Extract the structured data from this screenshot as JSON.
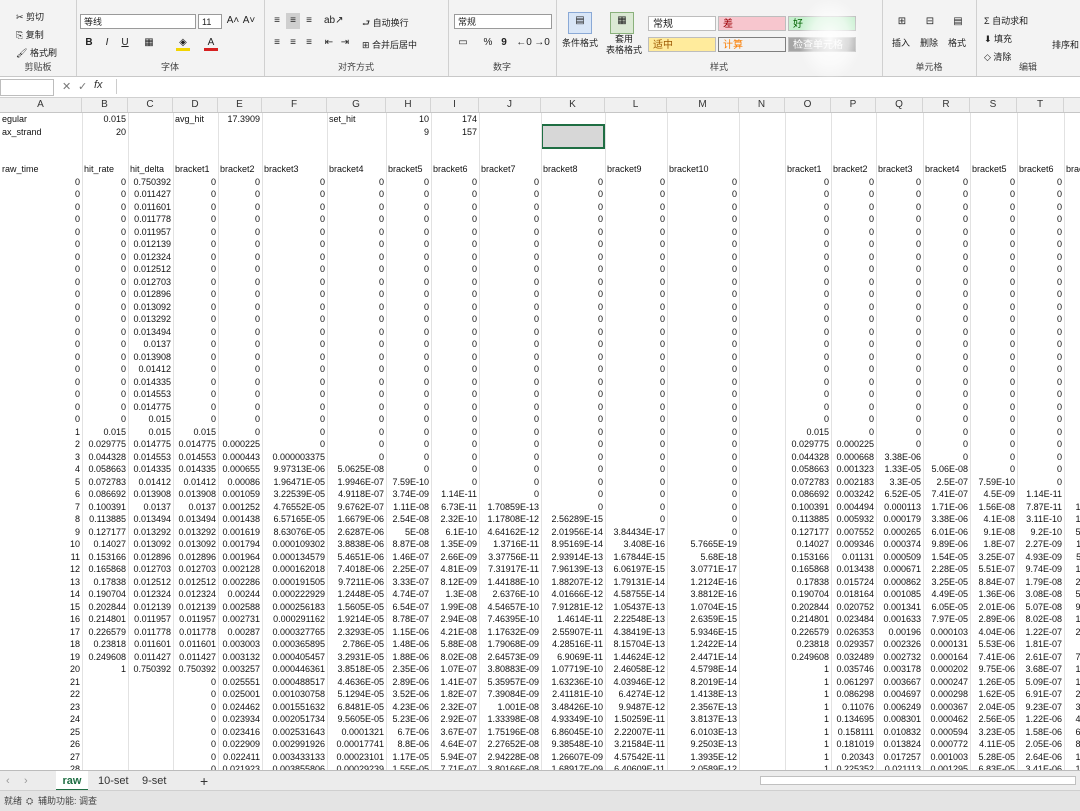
{
  "ribbon": {
    "clipboard": {
      "cut": "剪切",
      "copy": "复制",
      "format_painter": "格式刷",
      "label": "剪贴板"
    },
    "font": {
      "name": "等线",
      "size": "11",
      "label": "字体",
      "bold": "B",
      "italic": "I",
      "underline": "U",
      "grow": "A˄",
      "shrink": "A˅"
    },
    "alignment": {
      "wrap": "自动换行",
      "merge": "合并后居中",
      "label": "对齐方式"
    },
    "number": {
      "format": "常规",
      "percent": "%",
      "comma": "9",
      "label": "数字"
    },
    "styles": {
      "conditional": "条件格式",
      "table": "套用\n表格格式",
      "normal": "常规",
      "bad": "差",
      "good": "好",
      "neutral": "适中",
      "calc": "计算",
      "check": "检查单元格",
      "label": "样式"
    },
    "cells": {
      "insert": "插入",
      "delete": "删除",
      "format": "格式",
      "label": "单元格"
    },
    "editing": {
      "autosum": "自动求和",
      "fill": "填充",
      "clear": "清除",
      "sort": "排序和",
      "label": "编辑"
    }
  },
  "formula_bar": {
    "fx": "fx",
    "value": ""
  },
  "columns": [
    "A",
    "B",
    "C",
    "D",
    "E",
    "F",
    "G",
    "H",
    "I",
    "J",
    "K",
    "L",
    "M",
    "N",
    "O",
    "P",
    "Q",
    "R",
    "S",
    "T",
    "U"
  ],
  "top_rows": [
    [
      "egular",
      "0.015",
      "",
      "avg_hit",
      "17.3909",
      "",
      "set_hit",
      "10",
      "174"
    ],
    [
      "ax_strand",
      "20",
      "",
      "",
      "",
      "",
      "",
      "9",
      "157"
    ]
  ],
  "headers_left": [
    "raw_time",
    "hit_rate",
    "hit_delta",
    "bracket1",
    "bracket2",
    "bracket3",
    "bracket4",
    "bracket5",
    "bracket6",
    "bracket7",
    "bracket8",
    "bracket9",
    "bracket10"
  ],
  "headers_right": [
    "bracket1",
    "bracket2",
    "bracket3",
    "bracket4",
    "bracket5",
    "bracket6",
    "bracket7"
  ],
  "rows": [
    [
      "0",
      "0",
      "0.750392",
      "0",
      "0",
      "0",
      "0",
      "0",
      "0",
      "0",
      "0",
      "0",
      "0",
      "",
      "0",
      "0",
      "0",
      "0",
      "0",
      "0",
      "0"
    ],
    [
      "0",
      "0",
      "0.011427",
      "0",
      "0",
      "0",
      "0",
      "0",
      "0",
      "0",
      "0",
      "0",
      "0",
      "",
      "0",
      "0",
      "0",
      "0",
      "0",
      "0",
      "0"
    ],
    [
      "0",
      "0",
      "0.011601",
      "0",
      "0",
      "0",
      "0",
      "0",
      "0",
      "0",
      "0",
      "0",
      "0",
      "",
      "0",
      "0",
      "0",
      "0",
      "0",
      "0",
      "0"
    ],
    [
      "0",
      "0",
      "0.011778",
      "0",
      "0",
      "0",
      "0",
      "0",
      "0",
      "0",
      "0",
      "0",
      "0",
      "",
      "0",
      "0",
      "0",
      "0",
      "0",
      "0",
      "0"
    ],
    [
      "0",
      "0",
      "0.011957",
      "0",
      "0",
      "0",
      "0",
      "0",
      "0",
      "0",
      "0",
      "0",
      "0",
      "",
      "0",
      "0",
      "0",
      "0",
      "0",
      "0",
      "0"
    ],
    [
      "0",
      "0",
      "0.012139",
      "0",
      "0",
      "0",
      "0",
      "0",
      "0",
      "0",
      "0",
      "0",
      "0",
      "",
      "0",
      "0",
      "0",
      "0",
      "0",
      "0",
      "0"
    ],
    [
      "0",
      "0",
      "0.012324",
      "0",
      "0",
      "0",
      "0",
      "0",
      "0",
      "0",
      "0",
      "0",
      "0",
      "",
      "0",
      "0",
      "0",
      "0",
      "0",
      "0",
      "0"
    ],
    [
      "0",
      "0",
      "0.012512",
      "0",
      "0",
      "0",
      "0",
      "0",
      "0",
      "0",
      "0",
      "0",
      "0",
      "",
      "0",
      "0",
      "0",
      "0",
      "0",
      "0",
      "0"
    ],
    [
      "0",
      "0",
      "0.012703",
      "0",
      "0",
      "0",
      "0",
      "0",
      "0",
      "0",
      "0",
      "0",
      "0",
      "",
      "0",
      "0",
      "0",
      "0",
      "0",
      "0",
      "0"
    ],
    [
      "0",
      "0",
      "0.012896",
      "0",
      "0",
      "0",
      "0",
      "0",
      "0",
      "0",
      "0",
      "0",
      "0",
      "",
      "0",
      "0",
      "0",
      "0",
      "0",
      "0",
      "0"
    ],
    [
      "0",
      "0",
      "0.013092",
      "0",
      "0",
      "0",
      "0",
      "0",
      "0",
      "0",
      "0",
      "0",
      "0",
      "",
      "0",
      "0",
      "0",
      "0",
      "0",
      "0",
      "0"
    ],
    [
      "0",
      "0",
      "0.013292",
      "0",
      "0",
      "0",
      "0",
      "0",
      "0",
      "0",
      "0",
      "0",
      "0",
      "",
      "0",
      "0",
      "0",
      "0",
      "0",
      "0",
      "0"
    ],
    [
      "0",
      "0",
      "0.013494",
      "0",
      "0",
      "0",
      "0",
      "0",
      "0",
      "0",
      "0",
      "0",
      "0",
      "",
      "0",
      "0",
      "0",
      "0",
      "0",
      "0",
      "0"
    ],
    [
      "0",
      "0",
      "0.0137",
      "0",
      "0",
      "0",
      "0",
      "0",
      "0",
      "0",
      "0",
      "0",
      "0",
      "",
      "0",
      "0",
      "0",
      "0",
      "0",
      "0",
      "0"
    ],
    [
      "0",
      "0",
      "0.013908",
      "0",
      "0",
      "0",
      "0",
      "0",
      "0",
      "0",
      "0",
      "0",
      "0",
      "",
      "0",
      "0",
      "0",
      "0",
      "0",
      "0",
      "0"
    ],
    [
      "0",
      "0",
      "0.01412",
      "0",
      "0",
      "0",
      "0",
      "0",
      "0",
      "0",
      "0",
      "0",
      "0",
      "",
      "0",
      "0",
      "0",
      "0",
      "0",
      "0",
      "0"
    ],
    [
      "0",
      "0",
      "0.014335",
      "0",
      "0",
      "0",
      "0",
      "0",
      "0",
      "0",
      "0",
      "0",
      "0",
      "",
      "0",
      "0",
      "0",
      "0",
      "0",
      "0",
      "0"
    ],
    [
      "0",
      "0",
      "0.014553",
      "0",
      "0",
      "0",
      "0",
      "0",
      "0",
      "0",
      "0",
      "0",
      "0",
      "",
      "0",
      "0",
      "0",
      "0",
      "0",
      "0",
      "0"
    ],
    [
      "0",
      "0",
      "0.014775",
      "0",
      "0",
      "0",
      "0",
      "0",
      "0",
      "0",
      "0",
      "0",
      "0",
      "",
      "0",
      "0",
      "0",
      "0",
      "0",
      "0",
      "0"
    ],
    [
      "0",
      "0",
      "0.015",
      "0",
      "0",
      "0",
      "0",
      "0",
      "0",
      "0",
      "0",
      "0",
      "0",
      "",
      "0",
      "0",
      "0",
      "0",
      "0",
      "0",
      "0"
    ],
    [
      "1",
      "0.015",
      "0.015",
      "0.015",
      "0",
      "0",
      "0",
      "0",
      "0",
      "0",
      "0",
      "0",
      "0",
      "",
      "0.015",
      "0",
      "0",
      "0",
      "0",
      "0",
      "0"
    ],
    [
      "2",
      "0.029775",
      "0.014775",
      "0.014775",
      "0.000225",
      "0",
      "0",
      "0",
      "0",
      "0",
      "0",
      "0",
      "0",
      "",
      "0.029775",
      "0.000225",
      "0",
      "0",
      "0",
      "0",
      "0"
    ],
    [
      "3",
      "0.044328",
      "0.014553",
      "0.014553",
      "0.000443",
      "0.000003375",
      "0",
      "0",
      "0",
      "0",
      "0",
      "0",
      "0",
      "",
      "0.044328",
      "0.000668",
      "3.38E-06",
      "0",
      "0",
      "0",
      "0"
    ],
    [
      "4",
      "0.058663",
      "0.014335",
      "0.014335",
      "0.000655",
      "9.97313E-06",
      "5.0625E-08",
      "0",
      "0",
      "0",
      "0",
      "0",
      "0",
      "",
      "0.058663",
      "0.001323",
      "1.33E-05",
      "5.06E-08",
      "0",
      "0",
      "0"
    ],
    [
      "5",
      "0.072783",
      "0.01412",
      "0.01412",
      "0.00086",
      "1.96471E-05",
      "1.9946E-07",
      "7.59E-10",
      "0",
      "0",
      "0",
      "0",
      "0",
      "",
      "0.072783",
      "0.002183",
      "3.3E-05",
      "2.5E-07",
      "7.59E-10",
      "0",
      "0"
    ],
    [
      "6",
      "0.086692",
      "0.013908",
      "0.013908",
      "0.001059",
      "3.22539E-05",
      "4.9118E-07",
      "3.74E-09",
      "1.14E-11",
      "0",
      "0",
      "0",
      "0",
      "",
      "0.086692",
      "0.003242",
      "6.52E-05",
      "7.41E-07",
      "4.5E-09",
      "1.14E-11",
      "0"
    ],
    [
      "7",
      "0.100391",
      "0.0137",
      "0.0137",
      "0.001252",
      "4.76552E-05",
      "9.6762E-07",
      "1.11E-08",
      "6.73E-11",
      "1.70859E-13",
      "0",
      "0",
      "0",
      "",
      "0.100391",
      "0.004494",
      "0.000113",
      "1.71E-06",
      "1.56E-08",
      "7.87E-11",
      "1.71E-13"
    ],
    [
      "8",
      "0.113885",
      "0.013494",
      "0.013494",
      "0.001438",
      "6.57165E-05",
      "1.6679E-06",
      "2.54E-08",
      "2.32E-10",
      "1.17808E-12",
      "2.56289E-15",
      "0",
      "0",
      "",
      "0.113885",
      "0.005932",
      "0.000179",
      "3.38E-06",
      "4.1E-08",
      "3.11E-10",
      "1.35E-12"
    ],
    [
      "9",
      "0.127177",
      "0.013292",
      "0.013292",
      "0.001619",
      "8.63076E-05",
      "2.6287E-06",
      "5E-08",
      "6.1E-10",
      "4.64162E-12",
      "2.01956E-14",
      "3.84434E-17",
      "0",
      "",
      "0.127177",
      "0.007552",
      "0.000265",
      "6.01E-06",
      "9.1E-08",
      "9.2E-10",
      "5.99E-12"
    ],
    [
      "10",
      "0.14027",
      "0.013092",
      "0.013092",
      "0.001794",
      "0.000109302",
      "3.8838E-06",
      "8.87E-08",
      "1.35E-09",
      "1.3716E-11",
      "8.95169E-14",
      "3.408E-16",
      "5.7665E-19",
      "",
      "0.14027",
      "0.009346",
      "0.000374",
      "9.89E-06",
      "1.8E-07",
      "2.27E-09",
      "1.97E-11"
    ],
    [
      "11",
      "0.153166",
      "0.012896",
      "0.012896",
      "0.001964",
      "0.000134579",
      "5.4651E-06",
      "1.46E-07",
      "2.66E-09",
      "3.37756E-11",
      "2.93914E-13",
      "1.67844E-15",
      "5.68E-18",
      "",
      "0.153166",
      "0.01131",
      "0.000509",
      "1.54E-05",
      "3.25E-07",
      "4.93E-09",
      "5.35E-11"
    ],
    [
      "12",
      "0.165868",
      "0.012703",
      "0.012703",
      "0.002128",
      "0.000162018",
      "7.4018E-06",
      "2.25E-07",
      "4.81E-09",
      "7.31917E-11",
      "7.96139E-13",
      "6.06197E-15",
      "3.0771E-17",
      "",
      "0.165868",
      "0.013438",
      "0.000671",
      "2.28E-05",
      "5.51E-07",
      "9.74E-09",
      "1.27E-10"
    ],
    [
      "13",
      "0.17838",
      "0.012512",
      "0.012512",
      "0.002286",
      "0.000191505",
      "9.7211E-06",
      "3.33E-07",
      "8.12E-09",
      "1.44188E-10",
      "1.88207E-12",
      "1.79131E-14",
      "1.2124E-16",
      "",
      "0.17838",
      "0.015724",
      "0.000862",
      "3.25E-05",
      "8.84E-07",
      "1.79E-08",
      "2.71E-10"
    ],
    [
      "14",
      "0.190704",
      "0.012324",
      "0.012324",
      "0.00244",
      "0.000222929",
      "1.2448E-05",
      "4.74E-07",
      "1.3E-08",
      "2.6376E-10",
      "4.01666E-12",
      "4.58755E-14",
      "3.8812E-16",
      "",
      "0.190704",
      "0.018164",
      "0.001085",
      "4.49E-05",
      "1.36E-06",
      "3.08E-08",
      "5.35E-10"
    ],
    [
      "15",
      "0.202844",
      "0.012139",
      "0.012139",
      "0.002588",
      "0.000256183",
      "1.5605E-05",
      "6.54E-07",
      "1.99E-08",
      "4.54657E-10",
      "7.91281E-12",
      "1.05437E-13",
      "1.0704E-15",
      "",
      "0.202844",
      "0.020752",
      "0.001341",
      "6.05E-05",
      "2.01E-06",
      "5.07E-08",
      "9.89E-10"
    ],
    [
      "16",
      "0.214801",
      "0.011957",
      "0.011957",
      "0.002731",
      "0.000291162",
      "1.9214E-05",
      "8.78E-07",
      "2.94E-08",
      "7.46395E-10",
      "1.4614E-11",
      "2.22548E-13",
      "2.6359E-15",
      "",
      "0.214801",
      "0.023484",
      "0.001633",
      "7.97E-05",
      "2.89E-06",
      "8.02E-08",
      "1.74E-09"
    ],
    [
      "17",
      "0.226579",
      "0.011778",
      "0.011778",
      "0.00287",
      "0.000327765",
      "2.3293E-05",
      "1.15E-06",
      "4.21E-08",
      "1.17632E-09",
      "2.55907E-11",
      "4.38419E-13",
      "5.9346E-15",
      "",
      "0.226579",
      "0.026353",
      "0.00196",
      "0.000103",
      "4.04E-06",
      "1.22E-07",
      "2.91E-09"
    ],
    [
      "18",
      "0.23818",
      "0.011601",
      "0.011601",
      "0.003003",
      "0.000365895",
      "2.786E-05",
      "1.48E-06",
      "5.88E-08",
      "1.79068E-09",
      "4.28516E-11",
      "8.15704E-13",
      "1.2422E-14",
      "",
      "0.23818",
      "0.029357",
      "0.002326",
      "0.000131",
      "5.53E-06",
      "1.81E-07",
      "4.7E-09"
    ],
    [
      "19",
      "0.249608",
      "0.011427",
      "0.011427",
      "0.003132",
      "0.000405457",
      "3.2931E-05",
      "1.88E-06",
      "8.02E-08",
      "2.64573E-09",
      "6.9069E-11",
      "1.44624E-12",
      "2.4471E-14",
      "",
      "0.249608",
      "0.032489",
      "0.002732",
      "0.000164",
      "7.41E-06",
      "2.61E-07",
      "7.35E-09"
    ],
    [
      "20",
      "1",
      "0.750392",
      "0.750392",
      "0.003257",
      "0.000446361",
      "3.8518E-05",
      "2.35E-06",
      "1.07E-07",
      "3.80883E-09",
      "1.07719E-10",
      "2.46058E-12",
      "4.5798E-14",
      "",
      "1",
      "0.035746",
      "0.003178",
      "0.000202",
      "9.75E-06",
      "3.68E-07",
      "1.12E-08"
    ],
    [
      "21",
      "",
      "",
      "0",
      "0.025551",
      "0.000488517",
      "4.4636E-05",
      "2.89E-06",
      "1.41E-07",
      "5.35957E-09",
      "1.63236E-10",
      "4.03946E-12",
      "8.2019E-14",
      "",
      "1",
      "0.061297",
      "0.003667",
      "0.000247",
      "1.26E-05",
      "5.09E-07",
      "1.65E-08"
    ],
    [
      "22",
      "",
      "",
      "0",
      "0.025001",
      "0.001030758",
      "5.1294E-05",
      "3.52E-06",
      "1.82E-07",
      "7.39084E-09",
      "2.41181E-10",
      "6.4274E-12",
      "1.4138E-13",
      "",
      "1",
      "0.086298",
      "0.004697",
      "0.000298",
      "1.62E-05",
      "6.91E-07",
      "2.39E-08"
    ],
    [
      "23",
      "",
      "",
      "0",
      "0.024462",
      "0.001551632",
      "6.8481E-05",
      "4.23E-06",
      "2.32E-07",
      "1.001E-08",
      "3.48426E-10",
      "9.9487E-12",
      "2.3567E-13",
      "",
      "1",
      "0.11076",
      "0.006249",
      "0.000367",
      "2.04E-05",
      "9.23E-07",
      "3.39E-08"
    ],
    [
      "24",
      "",
      "",
      "0",
      "0.023934",
      "0.002051734",
      "9.5605E-05",
      "5.23E-06",
      "2.92E-07",
      "1.33398E-08",
      "4.93349E-10",
      "1.50259E-11",
      "3.8137E-13",
      "",
      "1",
      "0.134695",
      "0.008301",
      "0.000462",
      "2.56E-05",
      "1.22E-06",
      "4.73E-08"
    ],
    [
      "25",
      "",
      "",
      "0",
      "0.023416",
      "0.002531643",
      "0.0001321",
      "6.7E-06",
      "3.67E-07",
      "1.75196E-08",
      "6.86045E-10",
      "2.22007E-11",
      "6.0103E-13",
      "",
      "1",
      "0.158111",
      "0.010832",
      "0.000594",
      "3.23E-05",
      "1.58E-06",
      "6.48E-08"
    ],
    [
      "26",
      "",
      "",
      "0",
      "0.022909",
      "0.002991926",
      "0.00017741",
      "8.8E-06",
      "4.64E-07",
      "2.27652E-08",
      "9.38548E-10",
      "3.21584E-11",
      "9.2503E-13",
      "",
      "1",
      "0.181019",
      "0.013824",
      "0.000772",
      "4.11E-05",
      "2.05E-06",
      "8.75E-08"
    ],
    [
      "27",
      "",
      "",
      "0",
      "0.022411",
      "0.003433133",
      "0.00023101",
      "1.17E-05",
      "5.94E-07",
      "2.94228E-08",
      "1.26607E-09",
      "4.57542E-11",
      "1.3935E-12",
      "",
      "1",
      "0.20343",
      "0.017257",
      "0.001003",
      "5.28E-05",
      "2.64E-06",
      "1.17E-07"
    ],
    [
      "28",
      "",
      "",
      "0",
      "0.021923",
      "0.003855806",
      "0.00029239",
      "1.55E-05",
      "7.71E-07",
      "3.80166E-08",
      "1.68917E-09",
      "6.40609E-11",
      "2.0589E-12",
      "",
      "1",
      "0.225352",
      "0.021113",
      "0.001295",
      "6.83E-05",
      "3.41E-06",
      "1.55E-07"
    ]
  ],
  "sheet_tabs": [
    "raw",
    "10-set",
    "9-set"
  ],
  "active_tab": "raw",
  "add_tab": "+",
  "status": {
    "ready": "就绪",
    "accessibility": "辅助功能: 调查"
  }
}
